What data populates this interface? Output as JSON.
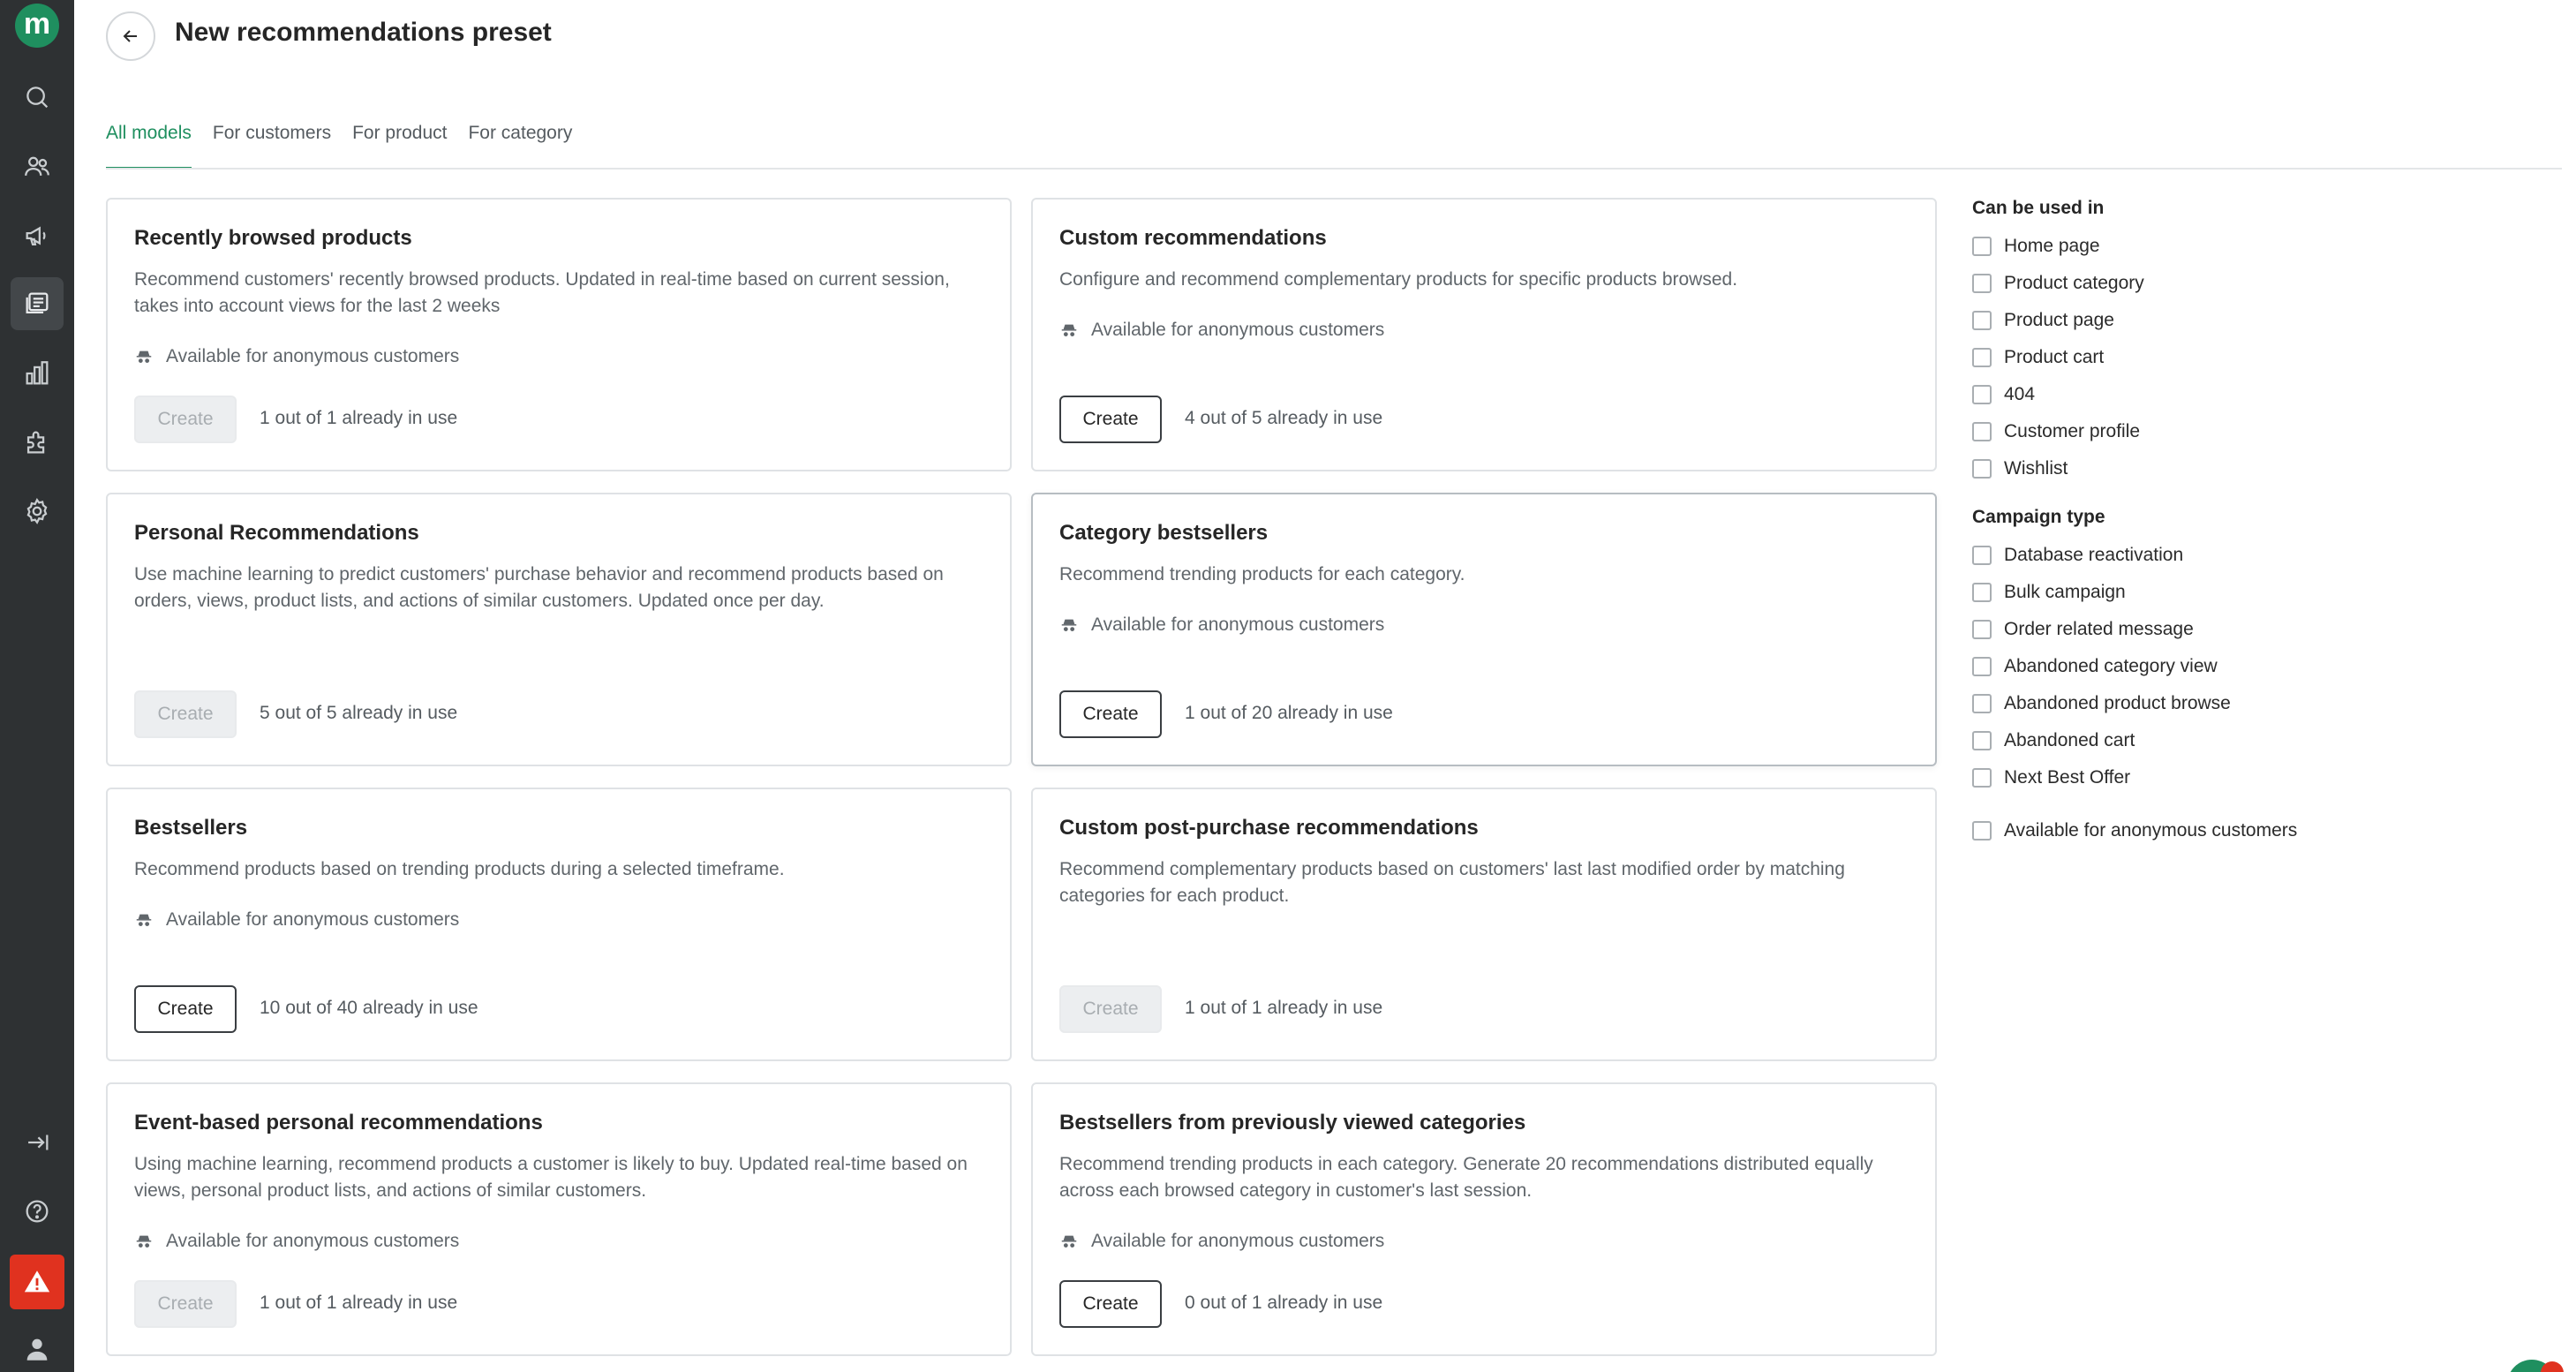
{
  "app": {
    "logo_letter": "m",
    "brand_color": "#1f8f5f",
    "alert_color": "#e0321f"
  },
  "header": {
    "title": "New recommendations preset"
  },
  "tabs": [
    {
      "label": "All models",
      "active": true
    },
    {
      "label": "For customers",
      "active": false
    },
    {
      "label": "For product",
      "active": false
    },
    {
      "label": "For category",
      "active": false
    }
  ],
  "cards": [
    {
      "title": "Recently browsed products",
      "description": "Recommend customers' recently browsed products. Updated in real-time based on current session, takes into account views for the last 2 weeks",
      "anonymous": "Available for anonymous customers",
      "button": "Create",
      "button_disabled": true,
      "usage": "1 out of 1 already in use"
    },
    {
      "title": "Custom recommendations",
      "description": "Configure and recommend complementary products for specific products browsed.",
      "anonymous": "Available for anonymous customers",
      "button": "Create",
      "button_disabled": false,
      "usage": "4 out of 5 already in use"
    },
    {
      "title": "Personal Recommendations",
      "description": "Use machine learning to predict customers' purchase behavior and recommend products based on orders, views, product lists, and actions of similar customers. Updated once per day.",
      "anonymous": "",
      "button": "Create",
      "button_disabled": true,
      "usage": "5 out of 5 already in use"
    },
    {
      "title": "Category bestsellers",
      "description": "Recommend trending products for each category.",
      "anonymous": "Available for anonymous customers",
      "button": "Create",
      "button_disabled": false,
      "usage": "1 out of 20 already in use"
    },
    {
      "title": "Bestsellers",
      "description": "Recommend products based on trending products during a selected timeframe.",
      "anonymous": "Available for anonymous customers",
      "button": "Create",
      "button_disabled": false,
      "usage": "10 out of 40 already in use"
    },
    {
      "title": "Custom post-purchase recommendations",
      "description": "Recommend complementary products based on customers' last last modified order by matching categories for each product.",
      "anonymous": "",
      "button": "Create",
      "button_disabled": true,
      "usage": "1 out of 1 already in use"
    },
    {
      "title": "Event-based personal recommendations",
      "description": "Using machine learning, recommend products a customer is likely to buy. Updated real-time based on views, personal product lists, and actions of similar customers.",
      "anonymous": "Available for anonymous customers",
      "button": "Create",
      "button_disabled": true,
      "usage": "1 out of 1 already in use"
    },
    {
      "title": "Bestsellers from previously viewed categories",
      "description": "Recommend trending products in each category. Generate 20 recommendations distributed equally across each browsed category in customer's last session.",
      "anonymous": "Available for anonymous customers",
      "button": "Create",
      "button_disabled": false,
      "usage": "0 out of 1 already in use"
    }
  ],
  "filters": {
    "usage_heading": "Can be used in",
    "usage_options": [
      "Home page",
      "Product category",
      "Product page",
      "Product cart",
      "404",
      "Customer profile",
      "Wishlist"
    ],
    "campaign_heading": "Campaign type",
    "campaign_options": [
      "Database reactivation",
      "Bulk campaign",
      "Order related message",
      "Abandoned category view",
      "Abandoned product browse",
      "Abandoned cart",
      "Next Best Offer"
    ],
    "anonymous_option": "Available for anonymous customers"
  }
}
